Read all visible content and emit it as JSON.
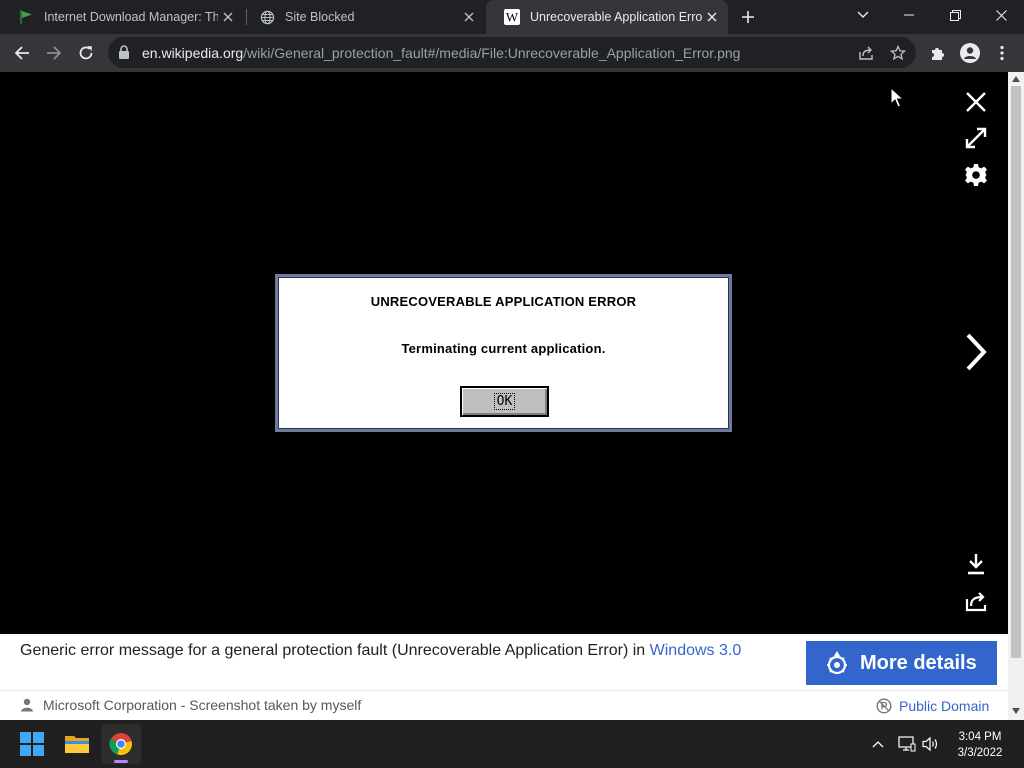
{
  "browser": {
    "tabs": [
      {
        "title": "Internet Download Manager: The",
        "favicon": "idm-flag-icon"
      },
      {
        "title": "Site Blocked",
        "favicon": "globe-icon"
      },
      {
        "title": "Unrecoverable Application Error",
        "favicon": "wikipedia-w-icon",
        "active": true
      }
    ],
    "url_host": "en.wikipedia.org",
    "url_path": "/wiki/General_protection_fault#/media/File:Unrecoverable_Application_Error.png"
  },
  "dialog": {
    "title": "UNRECOVERABLE APPLICATION ERROR",
    "message": "Terminating current application.",
    "ok_label": "OK"
  },
  "caption": {
    "description": "Generic error message for a general protection fault (Unrecoverable Application Error) in ",
    "description_link": "Windows 3.0",
    "more_details": "More details",
    "author": "Microsoft Corporation - Screenshot taken by myself",
    "license": "Public Domain"
  },
  "taskbar": {
    "time": "3:04 PM",
    "date": "3/3/2022"
  },
  "colors": {
    "accent": "#3366cc",
    "chrome_dark": "#202124",
    "chrome_toolbar": "#35363a"
  }
}
